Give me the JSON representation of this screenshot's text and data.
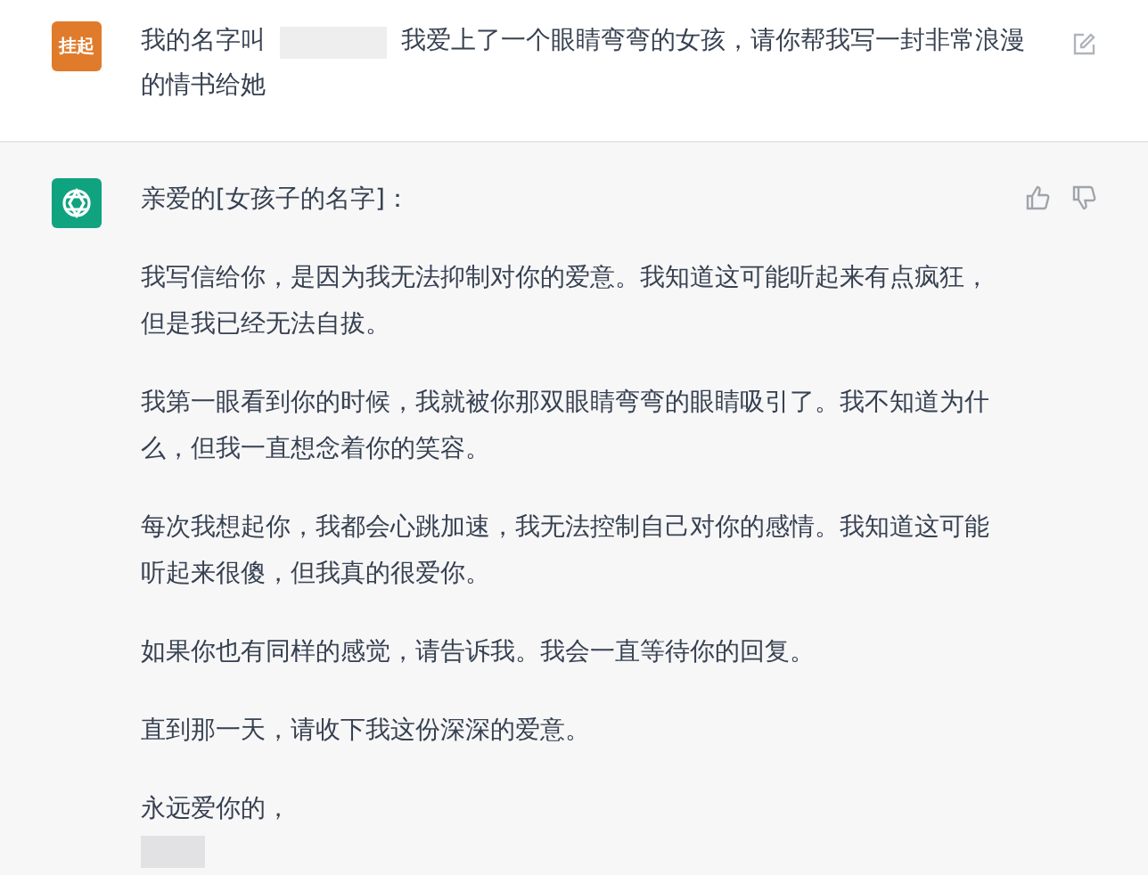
{
  "user_message": {
    "avatar_text": "挂起",
    "text_before_name": "我的名字叫",
    "text_after_name_lines": [
      "我爱上了一个眼睛弯弯的女孩，请你帮我写一封非常浪漫",
      "的情书给她"
    ]
  },
  "assistant_message": {
    "paragraphs": [
      "亲爱的[女孩子的名字]：",
      "我写信给你，是因为我无法抑制对你的爱意。我知道这可能听起来有点疯狂，但是我已经无法自拔。",
      "我第一眼看到你的时候，我就被你那双眼睛弯弯的眼睛吸引了。我不知道为什么，但我一直想念着你的笑容。",
      "每次我想起你，我都会心跳加速，我无法控制自己对你的感情。我知道这可能听起来很傻，但我真的很爱你。",
      "如果你也有同样的感觉，请告诉我。我会一直等待你的回复。",
      "直到那一天，请收下我这份深深的爱意。",
      "永远爱你的，"
    ]
  }
}
